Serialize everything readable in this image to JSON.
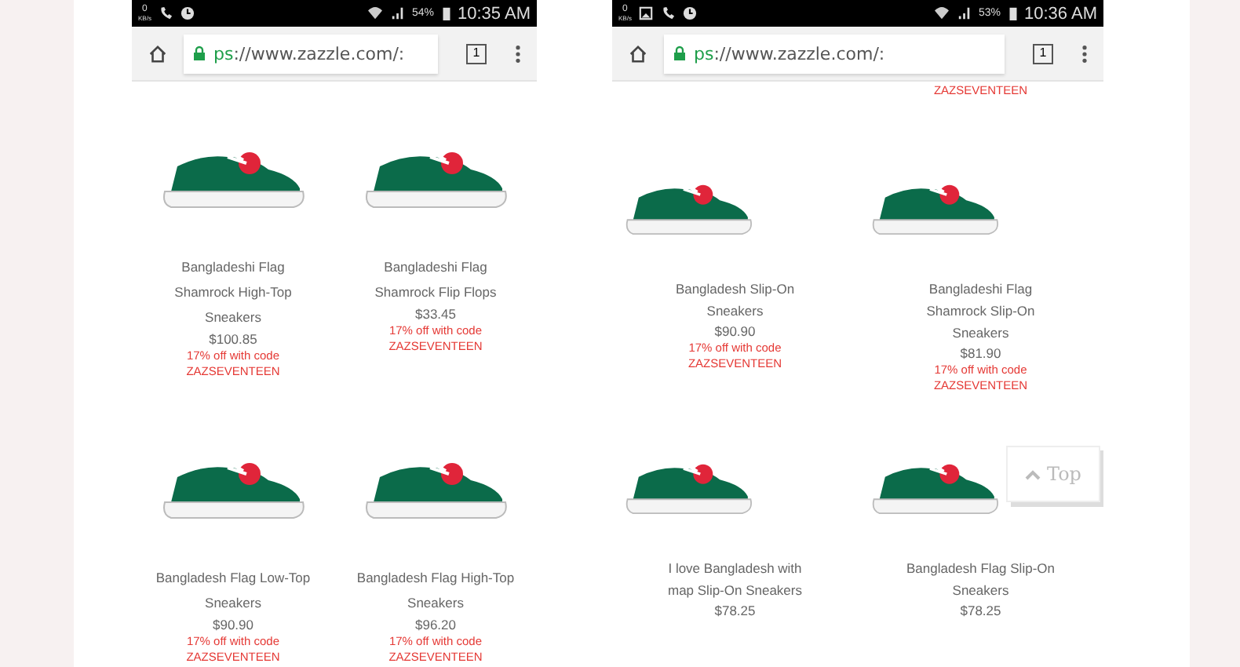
{
  "phones": [
    {
      "status": {
        "speed": "0",
        "speed_unit": "KB/s",
        "notification_icons": [
          {
            "kind": "phone"
          },
          {
            "kind": "clock"
          }
        ],
        "battery": "54%",
        "time": "10:35 AM"
      },
      "address_bar": {
        "url": "ps://www.zazzle.com/:",
        "tab_count": "1"
      },
      "products": [
        {
          "kind": "product",
          "title": [
            "Bangladeshi Flag",
            "Shamrock High-Top",
            "Sneakers"
          ],
          "price": "$100.85",
          "promo": [
            "17% off with code",
            "ZAZSEVENTEEN"
          ]
        },
        {
          "kind": "product",
          "title": [
            "Bangladeshi Flag",
            "Shamrock Flip Flops"
          ],
          "price": "$33.45",
          "promo": [
            "17% off with code",
            "ZAZSEVENTEEN"
          ]
        },
        {
          "kind": "product",
          "title": [
            "Bangladesh Flag Low-Top",
            "Sneakers"
          ],
          "price": "$90.90",
          "promo": [
            "17% off with code",
            "ZAZSEVENTEEN"
          ]
        },
        {
          "kind": "product",
          "title": [
            "Bangladesh Flag High-Top",
            "Sneakers"
          ],
          "price": "$96.20",
          "promo": [
            "17% off with code",
            "ZAZSEVENTEEN"
          ]
        }
      ]
    },
    {
      "status": {
        "speed": "0",
        "speed_unit": "KB/s",
        "notification_icons": [
          {
            "kind": "image"
          },
          {
            "kind": "phone"
          },
          {
            "kind": "clock"
          }
        ],
        "battery": "53%",
        "time": "10:36 AM"
      },
      "address_bar": {
        "url": "ps://www.zazzle.com/:",
        "tab_count": "1"
      },
      "products": [
        {
          "kind": "tail"
        },
        {
          "kind": "tail",
          "promo": [
            "ZAZSEVENTEEN"
          ]
        },
        {
          "kind": "product",
          "title": [
            "Bangladesh Slip-On",
            "Sneakers"
          ],
          "price": "$90.90",
          "promo": [
            "17% off with code",
            "ZAZSEVENTEEN"
          ]
        },
        {
          "kind": "product",
          "title": [
            "Bangladeshi Flag",
            "Shamrock Slip-On",
            "Sneakers"
          ],
          "price": "$81.90",
          "promo": [
            "17% off with code",
            "ZAZSEVENTEEN"
          ]
        },
        {
          "kind": "product",
          "title": [
            "I love Bangladesh with",
            "map Slip-On Sneakers"
          ],
          "price": "$78.25"
        },
        {
          "kind": "product",
          "title": [
            "Bangladesh Flag Slip-On",
            "Sneakers"
          ],
          "price": "$78.25"
        }
      ],
      "top_button": {
        "label": "Top"
      }
    }
  ]
}
